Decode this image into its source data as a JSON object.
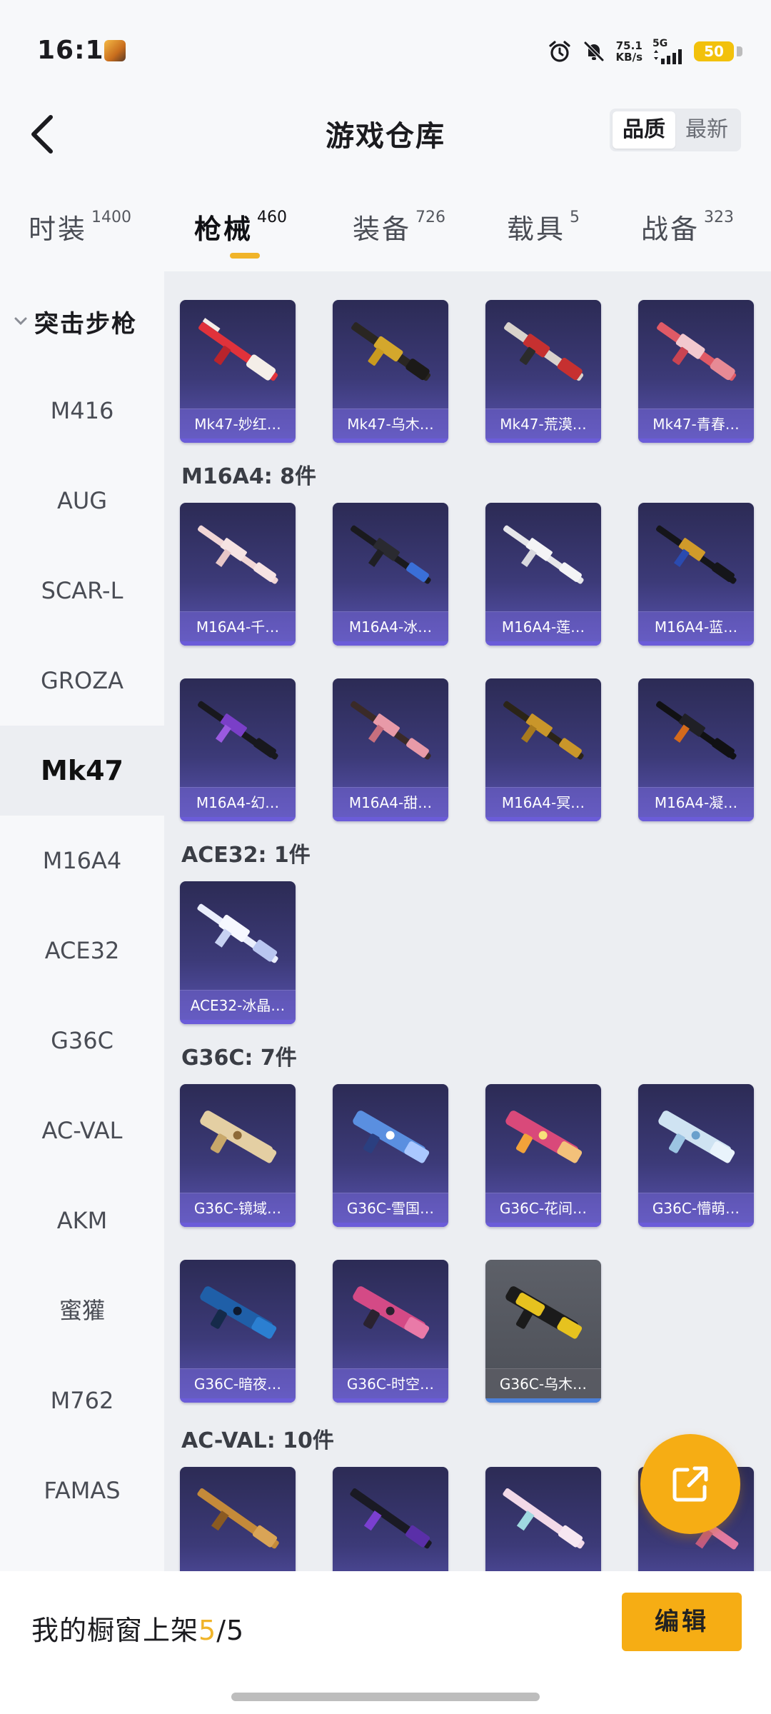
{
  "status_bar": {
    "time": "16:11",
    "net_speed_value": "75.1",
    "net_speed_unit": "KB/s",
    "signal": "5G",
    "battery": "50"
  },
  "header": {
    "title": "游戏仓库",
    "sort_options": [
      "品质",
      "最新"
    ],
    "sort_active": "品质"
  },
  "tabs": [
    {
      "label": "时装",
      "count": "1400"
    },
    {
      "label": "枪械",
      "count": "460"
    },
    {
      "label": "装备",
      "count": "726"
    },
    {
      "label": "载具",
      "count": "5"
    },
    {
      "label": "战备",
      "count": "323"
    }
  ],
  "active_tab": "枪械",
  "sidebar": {
    "group": "突击步枪",
    "items": [
      "M416",
      "AUG",
      "SCAR-L",
      "GROZA",
      "Mk47",
      "M16A4",
      "ACE32",
      "G36C",
      "AC-VAL",
      "AKM",
      "蜜獾",
      "M762",
      "FAMAS"
    ],
    "active": "Mk47"
  },
  "sections": {
    "mk47": {
      "items": [
        "Mk47-妙红…",
        "Mk47-乌木…",
        "Mk47-荒漠…",
        "Mk47-青春…"
      ]
    },
    "m16a4": {
      "label": "M16A4: 8件",
      "items": [
        "M16A4-千…",
        "M16A4-冰…",
        "M16A4-莲…",
        "M16A4-蓝…",
        "M16A4-幻…",
        "M16A4-甜…",
        "M16A4-冥…",
        "M16A4-凝…"
      ]
    },
    "ace32": {
      "label": "ACE32: 1件",
      "items": [
        "ACE32-冰晶…"
      ]
    },
    "g36c": {
      "label": "G36C: 7件",
      "items": [
        "G36C-镜域…",
        "G36C-雪国…",
        "G36C-花间…",
        "G36C-懵萌…",
        "G36C-暗夜…",
        "G36C-时空…",
        "G36C-乌木…"
      ]
    },
    "acval": {
      "label": "AC-VAL: 10件"
    }
  },
  "bottom": {
    "showcase_prefix": "我的橱窗上架",
    "showcase_current": "5",
    "showcase_sep": "/",
    "showcase_total": "5",
    "edit_label": "编辑"
  },
  "colors": {
    "accent": "#f6ad14",
    "card_bg": "#3c3a78",
    "card_caption": "#6b5cd9"
  },
  "icons": [
    "back-arrow-icon",
    "alarm-icon",
    "mute-bell-icon",
    "signal-icon",
    "chevron-down-icon",
    "share-external-icon"
  ]
}
